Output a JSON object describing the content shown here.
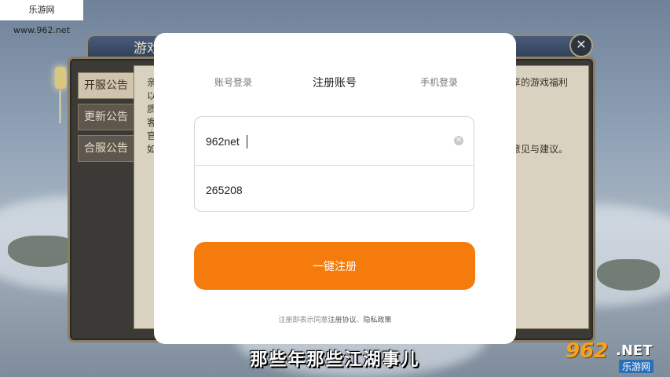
{
  "watermark": {
    "site": "乐游网 www.962.net"
  },
  "game": {
    "title": "游戏",
    "tabs": [
      {
        "label": "开服公告"
      },
      {
        "label": "更新公告"
      },
      {
        "label": "合服公告"
      }
    ],
    "content_lines": [
      "亲",
      "以",
      "质",
      "客",
      "官",
      "如"
    ],
    "content_right_1": "享的游戏福利",
    "content_right_2": "意见与建议。"
  },
  "modal": {
    "tabs": [
      {
        "label": "账号登录"
      },
      {
        "label": "注册账号"
      },
      {
        "label": "手机登录"
      }
    ],
    "account_value": "962net",
    "password_value": "265208",
    "register_button": "一键注册",
    "agreement_prefix": "注册即表示同意",
    "agreement_link1": "注册协议",
    "agreement_sep": "、",
    "agreement_link2": "隐私政策"
  },
  "subtitle": "那些年那些江湖事儿",
  "brand": {
    "num": "962",
    "net": ".NET",
    "sub": "乐游网"
  }
}
